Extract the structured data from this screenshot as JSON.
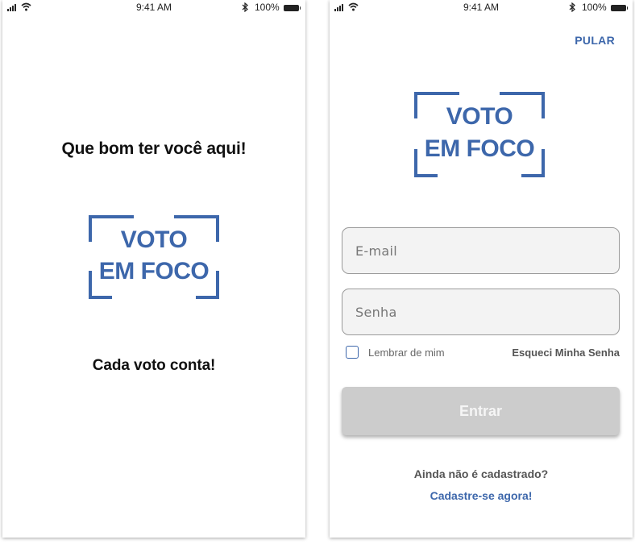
{
  "status_bar": {
    "time": "9:41 AM",
    "battery": "100%"
  },
  "logo": {
    "line1": "VOTO",
    "line2": "EM FOCO"
  },
  "welcome_screen": {
    "greeting": "Que bom ter você aqui!",
    "tagline": "Cada voto conta!"
  },
  "login_screen": {
    "skip_label": "PULAR",
    "email_placeholder": "E-mail",
    "password_placeholder": "Senha",
    "remember_label": "Lembrar de mim",
    "remember_checked": false,
    "forgot_label": "Esqueci Minha Senha",
    "enter_label": "Entrar",
    "not_registered": "Ainda não é cadastrado?",
    "signup_label": "Cadastre-se agora!"
  },
  "colors": {
    "brand_blue": "#3d67ab",
    "button_disabled": "#cccccc",
    "field_bg": "#f3f3f3"
  },
  "icons": [
    "signal-icon",
    "wifi-icon",
    "bluetooth-icon",
    "battery-icon",
    "checkbox-icon"
  ]
}
